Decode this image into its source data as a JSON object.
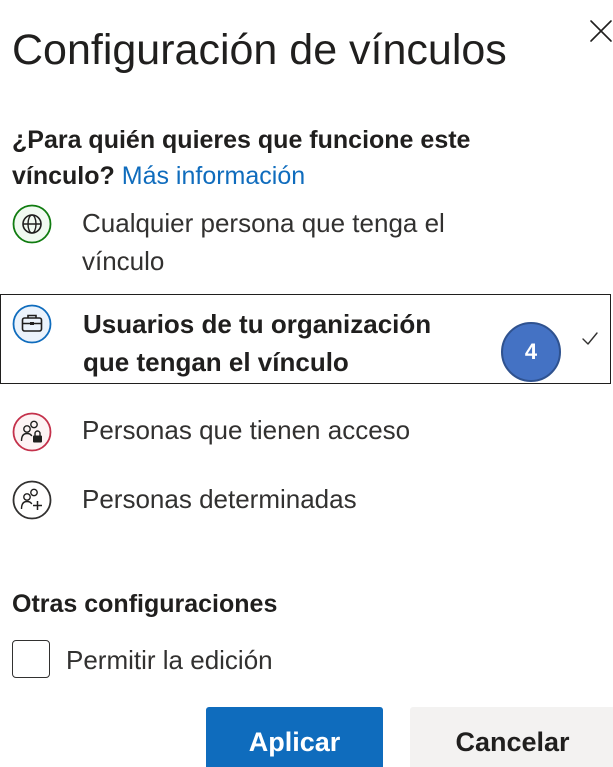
{
  "dialog": {
    "title": "Configuración de vínculos"
  },
  "question": {
    "text": "¿Para quién quieres que funcione este vínculo?",
    "link": "Más información"
  },
  "options": [
    {
      "label": "Cualquier persona que tenga el vínculo",
      "icon": "globe-icon",
      "color": "#107c10",
      "selected": false
    },
    {
      "label": "Usuarios de tu organización que tengan el vínculo",
      "icon": "briefcase-icon",
      "color": "#0f6cbd",
      "selected": true
    },
    {
      "label": "Personas que tienen acceso",
      "icon": "people-lock-icon",
      "color": "#c4314b",
      "selected": false
    },
    {
      "label": "Personas determinadas",
      "icon": "people-add-icon",
      "color": "#323130",
      "selected": false
    }
  ],
  "annotation": {
    "badge": "4"
  },
  "other_settings": {
    "title": "Otras configuraciones",
    "allow_edit_label": "Permitir la edición",
    "allow_edit_checked": false
  },
  "buttons": {
    "apply": "Aplicar",
    "cancel": "Cancelar"
  },
  "colors": {
    "accent": "#0f6cbd",
    "badge": "#4472c4"
  }
}
